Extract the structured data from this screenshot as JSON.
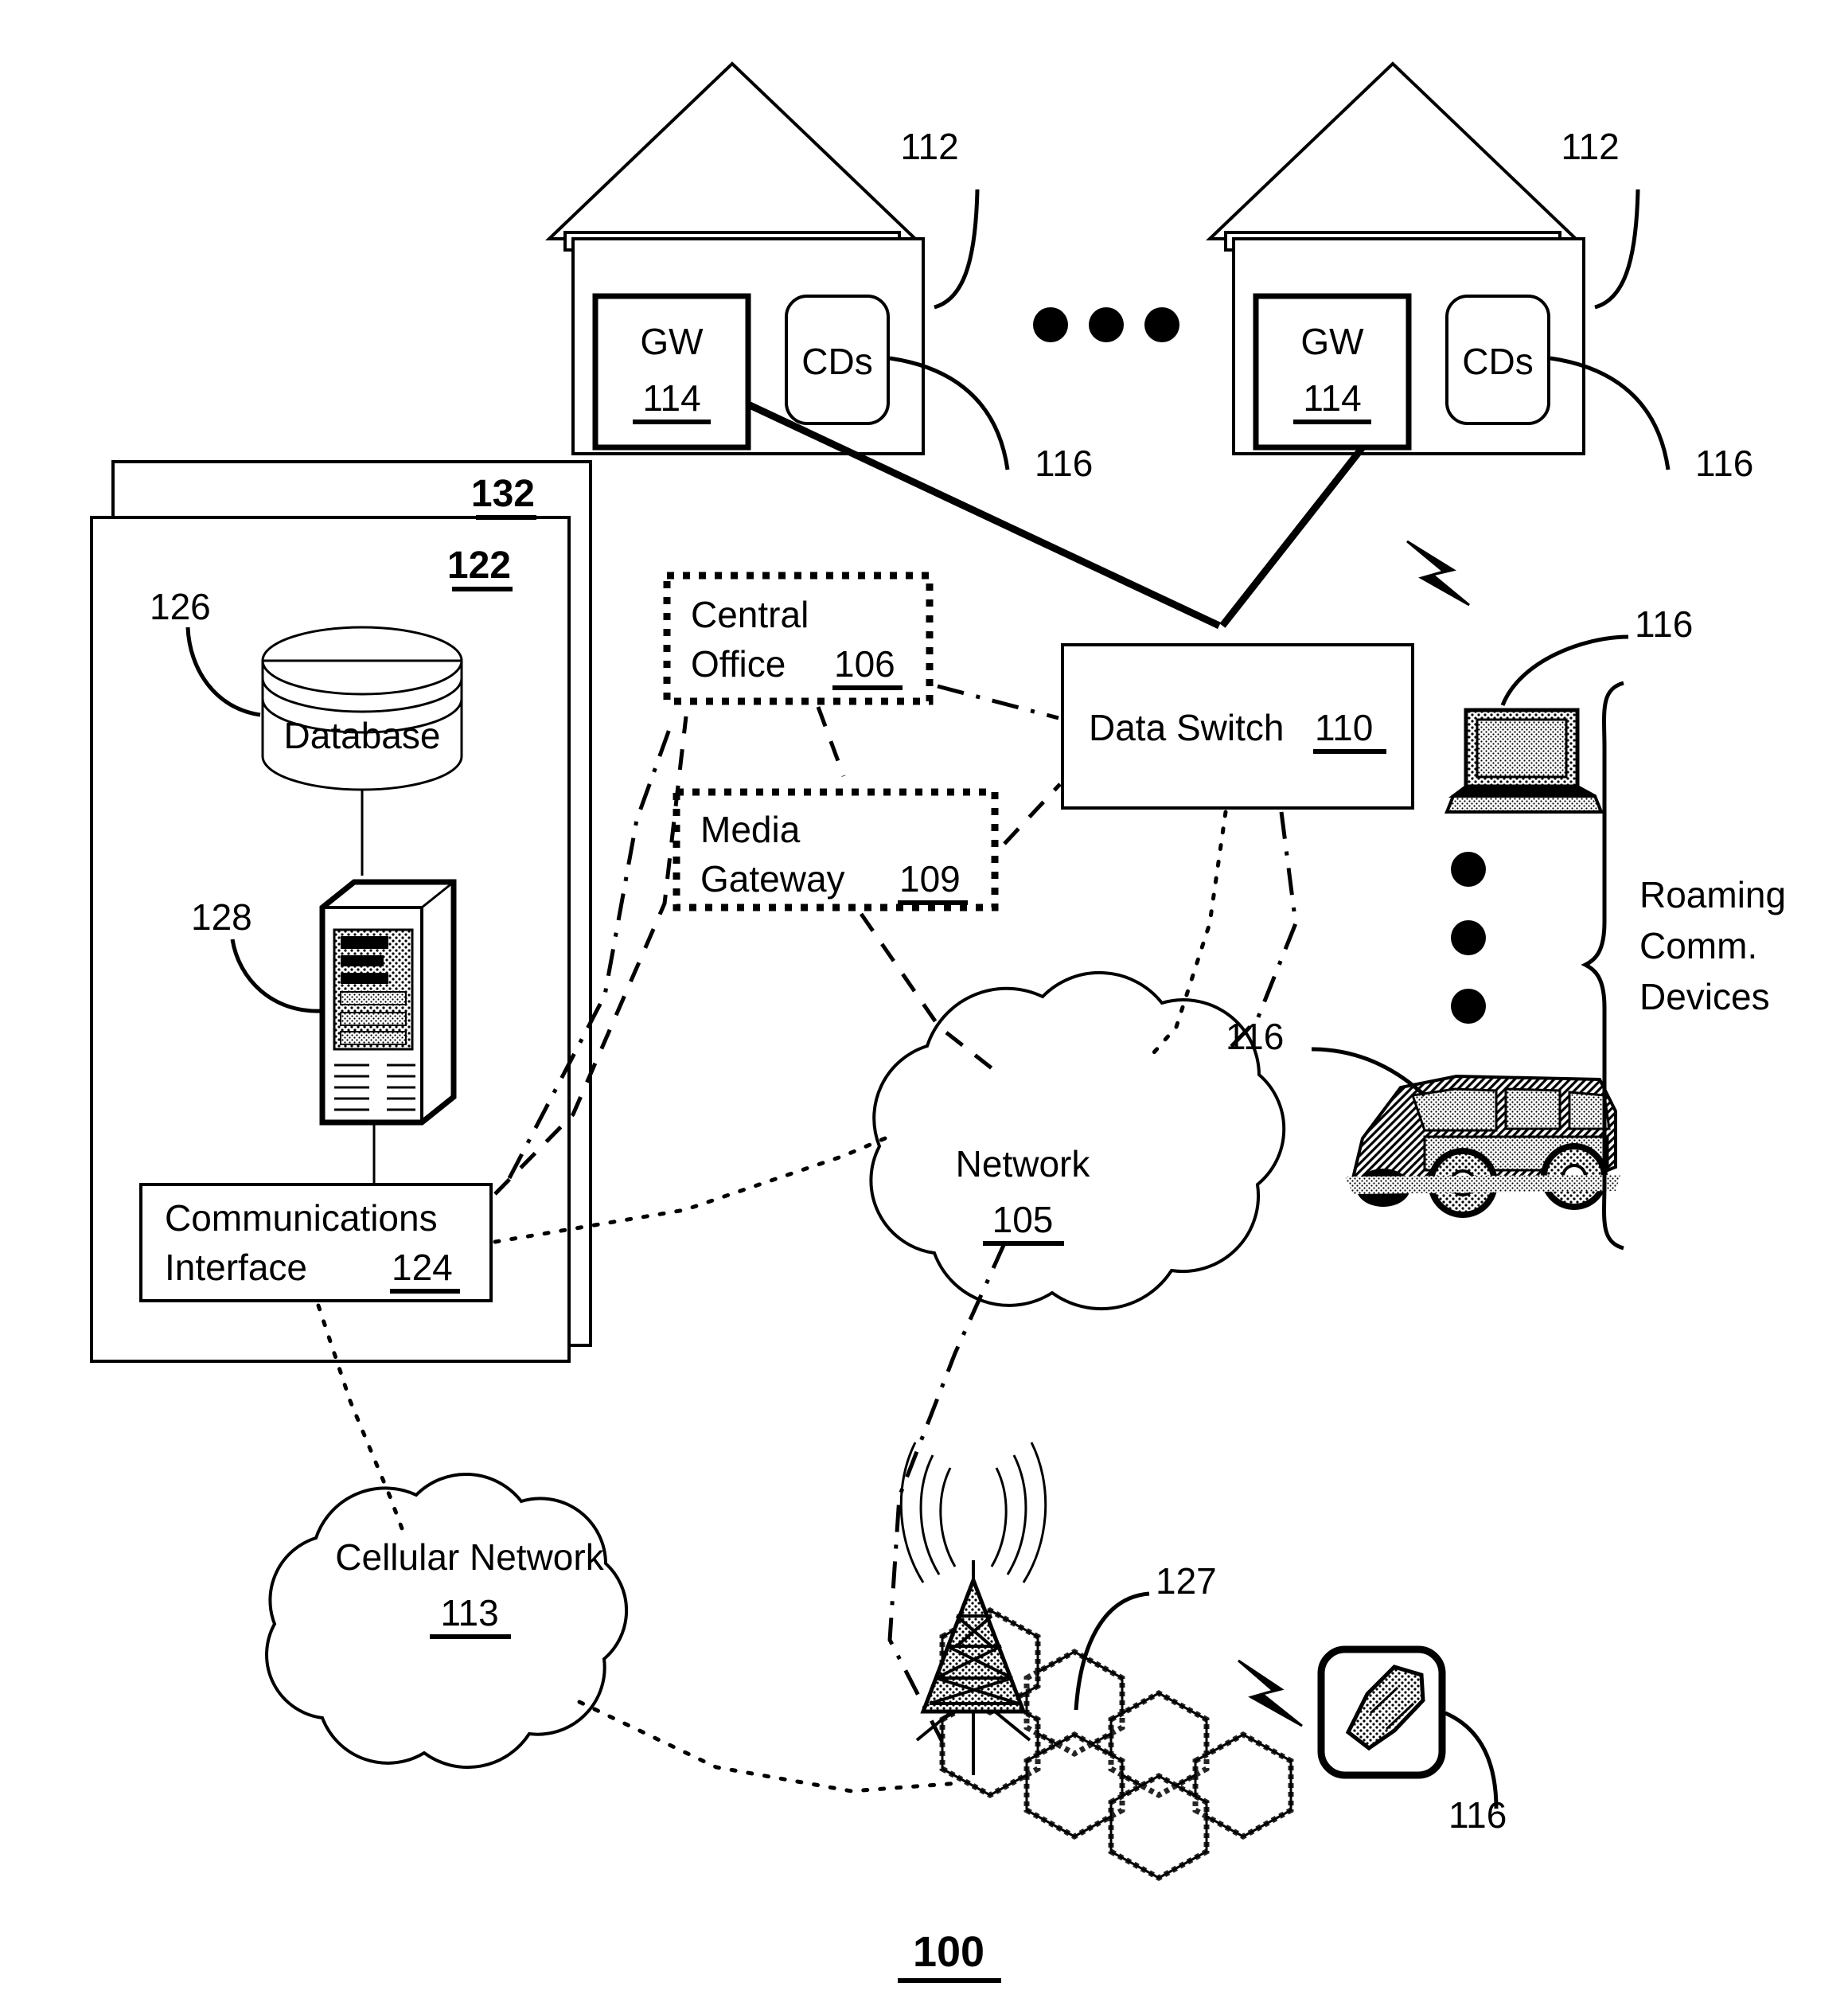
{
  "figure": {
    "number": "100",
    "type": "patent-network-diagram"
  },
  "premises": [
    {
      "id": "house-left",
      "ref": "112",
      "gateway": {
        "label": "GW",
        "ref": "114"
      },
      "devices": {
        "label": "CDs",
        "ref": "116"
      }
    },
    {
      "id": "house-right",
      "ref": "112",
      "gateway": {
        "label": "GW",
        "ref": "114"
      },
      "devices": {
        "label": "CDs",
        "ref": "116"
      }
    }
  ],
  "ellipsis_between_houses": "• • •",
  "service_provider": {
    "outer_box_ref": "132",
    "inner_box_ref": "122",
    "database": {
      "label": "Database",
      "ref": "126"
    },
    "server": {
      "ref": "128"
    },
    "comm_interface": {
      "line1": "Communications",
      "line2": "Interface",
      "ref": "124"
    }
  },
  "nodes": {
    "central_office": {
      "line1": "Central",
      "line2": "Office",
      "ref": "106"
    },
    "media_gateway": {
      "line1": "Media",
      "line2": "Gateway",
      "ref": "109"
    },
    "data_switch": {
      "label": "Data Switch",
      "ref": "110"
    },
    "network": {
      "label": "Network",
      "ref": "105"
    },
    "cellular_network": {
      "label": "Cellular Network",
      "ref": "113"
    },
    "cell_site": {
      "ref": "127"
    }
  },
  "roaming": {
    "bracket_label_line1": "Roaming",
    "bracket_label_line2": "Comm.",
    "bracket_label_line3": "Devices",
    "laptop_ref": "116",
    "vehicle_ref": "116",
    "handset_ref": "116"
  },
  "colors": {
    "line": "#000000",
    "background": "#ffffff"
  }
}
